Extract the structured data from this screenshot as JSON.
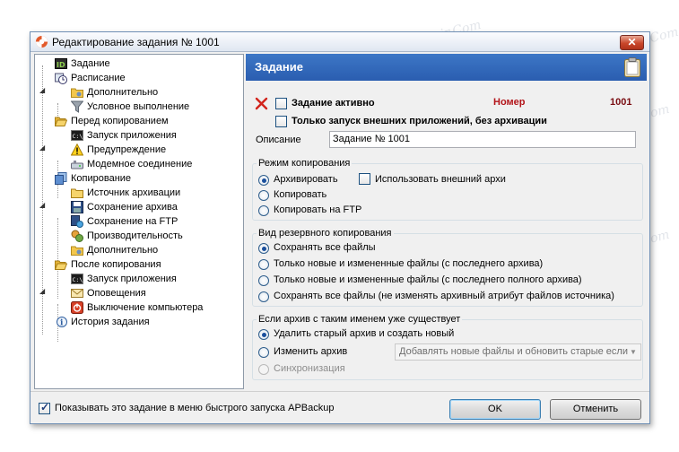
{
  "window": {
    "title": "Редактирование задания № 1001",
    "close_symbol": "✕"
  },
  "tree": [
    {
      "label": "Задание",
      "icon": "id-icon"
    },
    {
      "label": "Расписание",
      "icon": "clock-icon"
    },
    {
      "label": "Дополнительно",
      "icon": "folder-gear-icon"
    },
    {
      "label": "Условное выполнение",
      "icon": "filter-icon"
    },
    {
      "label": "Перед копированием",
      "icon": "folder-open-icon"
    },
    {
      "label": "Запуск приложения",
      "icon": "console-icon"
    },
    {
      "label": "Предупреждение",
      "icon": "warning-icon"
    },
    {
      "label": "Модемное соединение",
      "icon": "modem-icon"
    },
    {
      "label": "Копирование",
      "icon": "copy-icon"
    },
    {
      "label": "Источник архивации",
      "icon": "folder-source-icon"
    },
    {
      "label": "Сохранение архива",
      "icon": "save-disk-icon"
    },
    {
      "label": "Сохранение на FTP",
      "icon": "ftp-icon"
    },
    {
      "label": "Производительность",
      "icon": "performance-icon"
    },
    {
      "label": "Дополнительно",
      "icon": "folder-gear-icon"
    },
    {
      "label": "После копирования",
      "icon": "folder-open-icon"
    },
    {
      "label": "Запуск приложения",
      "icon": "console-icon"
    },
    {
      "label": "Оповещения",
      "icon": "envelope-icon"
    },
    {
      "label": "Выключение компьютера",
      "icon": "power-icon"
    },
    {
      "label": "История задания",
      "icon": "history-icon"
    }
  ],
  "header": {
    "title": "Задание",
    "icon": "clipboard-icon"
  },
  "task": {
    "active_label": "Задание активно",
    "active_checked": false,
    "number_label": "Номер",
    "number_value": "1001",
    "only_apps_label": "Только запуск внешних приложений, без архивации",
    "only_apps_checked": false,
    "description_label": "Описание",
    "description_value": "Задание № 1001",
    "status_icon": "red-x-icon"
  },
  "copy_mode": {
    "title": "Режим копирования",
    "options": [
      "Архивировать",
      "Копировать",
      "Копировать на FTP"
    ],
    "selected": 0,
    "external_archiver_label": "Использовать внешний архи",
    "external_archiver_checked": false
  },
  "backup_type": {
    "title": "Вид резервного копирования",
    "options": [
      "Сохранять все файлы",
      "Только новые и измененные файлы (с последнего архива)",
      "Только новые и измененные файлы (с последнего полного архива)",
      "Сохранять все файлы (не изменять архивный атрибут файлов источника)"
    ],
    "selected": 0
  },
  "existing_archive": {
    "title": "Если архив с таким именем уже существует",
    "options": [
      "Удалить старый архив и создать новый",
      "Изменить архив",
      "Синхронизация"
    ],
    "selected": 0,
    "combo_value": "Добавлять новые файлы и обновить старые если"
  },
  "footer": {
    "quick_menu_label": "Показывать это задание в меню быстрого запуска APBackup",
    "quick_menu_checked": true,
    "ok_label": "OK",
    "cancel_label": "Отменить"
  },
  "watermark_text": "Sovingparpair.Com"
}
